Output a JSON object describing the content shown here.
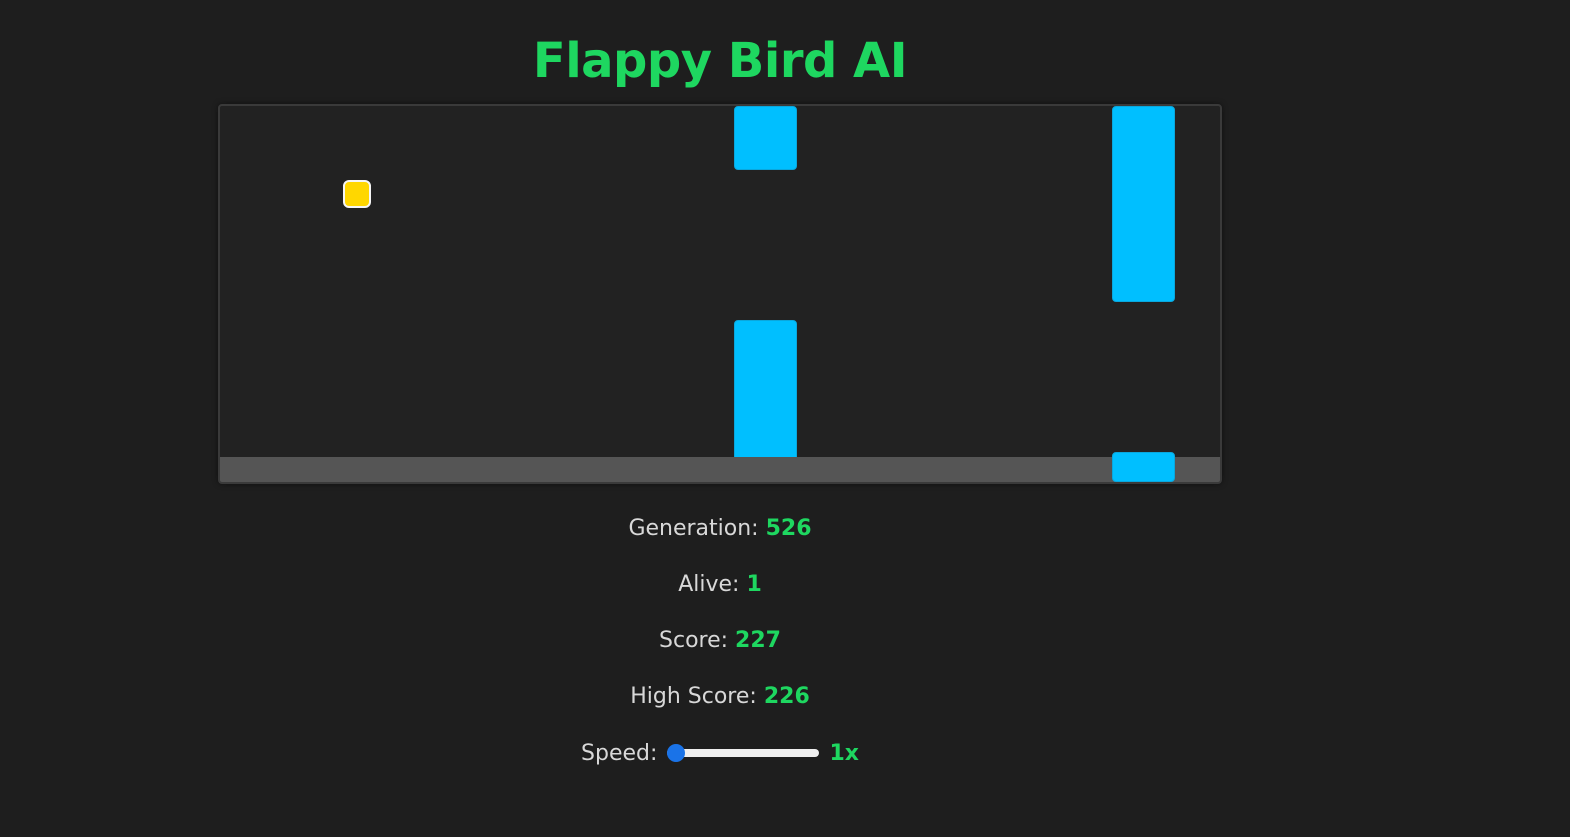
{
  "title": "Flappy Bird AI",
  "game": {
    "bird_color": "#ffd700",
    "pipe_color": "#00bfff",
    "ground_color": "#555555"
  },
  "stats": {
    "generation_label": "Generation:",
    "generation_value": "526",
    "alive_label": "Alive:",
    "alive_value": "1",
    "score_label": "Score:",
    "score_value": "227",
    "high_score_label": "High Score:",
    "high_score_value": "226"
  },
  "speed": {
    "label": "Speed:",
    "value_label": "1x",
    "value": 1,
    "slider_fraction": 0.0
  },
  "colors": {
    "accent": "#1ed760",
    "background": "#1e1e1e"
  }
}
